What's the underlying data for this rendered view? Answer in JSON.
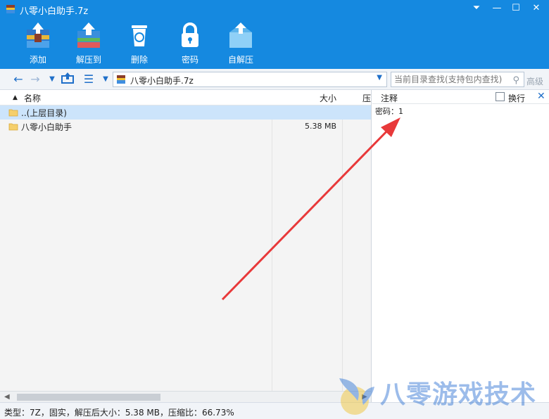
{
  "window": {
    "title": "八零小白助手.7z",
    "controls": {
      "menu": "⏷",
      "minimize": "—",
      "maximize": "☐",
      "close": "✕"
    }
  },
  "toolbar": {
    "items": [
      {
        "label": "添加",
        "icon": "add-archive-icon"
      },
      {
        "label": "解压到",
        "icon": "extract-to-icon"
      },
      {
        "label": "删除",
        "icon": "trash-icon"
      },
      {
        "label": "密码",
        "icon": "lock-icon"
      },
      {
        "label": "自解压",
        "icon": "self-extract-icon"
      }
    ]
  },
  "navbar": {
    "path": "八零小白助手.7z",
    "search_placeholder": "当前目录查找(支持包内查找)",
    "advanced": "高级"
  },
  "filelist": {
    "columns": {
      "name": "名称",
      "size": "大小",
      "compressed": "压"
    },
    "rows": [
      {
        "name": "..(上层目录)",
        "size": "",
        "selected": true
      },
      {
        "name": "八零小白助手",
        "size": "5.38 MB",
        "selected": false
      }
    ]
  },
  "comment": {
    "title": "注释",
    "wrap_label": "换行",
    "close": "✕",
    "text": "密码：1"
  },
  "statusbar": {
    "text": "类型：7Z，固实，解压后大小：5.38 MB，压缩比：66.73%"
  },
  "watermark": {
    "text": "八零游戏技术"
  },
  "colors": {
    "accent": "#1589e0",
    "arrow": "#e8393a",
    "selection": "#cce4fb"
  }
}
